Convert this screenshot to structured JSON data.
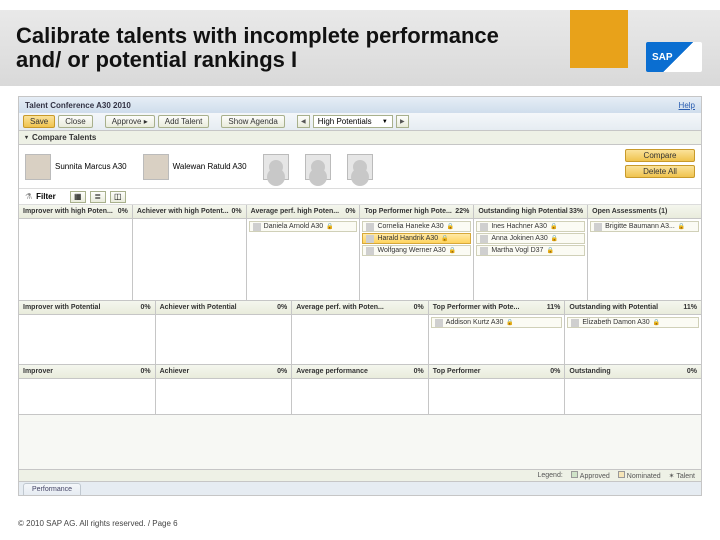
{
  "slide": {
    "title": "Calibrate talents with incomplete performance and/ or potential rankings I",
    "logo": "SAP",
    "footer": "© 2010 SAP AG. All rights reserved. / Page 6"
  },
  "app": {
    "title": "Talent Conference A30 2010",
    "help": "Help"
  },
  "toolbar": {
    "save": "Save",
    "close": "Close",
    "approve": "Approve ▸",
    "add_talent": "Add Talent",
    "show_agenda": "Show Agenda",
    "prev": "◀",
    "next": "▶",
    "dropdown_label": "High Potentials",
    "dropdown_arrow": "▼"
  },
  "section": {
    "compare": "Compare Talents",
    "arrow": "▾"
  },
  "talents": [
    {
      "name": "Sunnita Marcus A30"
    },
    {
      "name": "Walewan Ratuld A30"
    }
  ],
  "side": {
    "compare": "Compare",
    "delete": "Delete All"
  },
  "filter": {
    "label": "Filter",
    "funnel": "▾"
  },
  "grid": {
    "rows": [
      {
        "h": "r1",
        "cells": [
          {
            "title": "Improver with high Poten...",
            "pct": "0%",
            "items": []
          },
          {
            "title": "Achiever with high Potent...",
            "pct": "0%",
            "items": []
          },
          {
            "title": "Average perf. high Poten...",
            "pct": "0%",
            "items": [
              {
                "t": "Daniela Arnold A30"
              }
            ]
          },
          {
            "title": "Top Performer high Pote...",
            "pct": "22%",
            "items": [
              {
                "t": "Cornelia Haneke A30"
              },
              {
                "t": "Harald Handrik A30",
                "sel": true
              },
              {
                "t": "Wolfgang Werner A30"
              }
            ]
          },
          {
            "title": "Outstanding high Potential",
            "pct": "33%",
            "items": [
              {
                "t": "Ines Hachner A30"
              },
              {
                "t": "Anna Jokinen A30"
              },
              {
                "t": "Martha Vogl D37"
              }
            ]
          },
          {
            "title": "Open Assessments (1)",
            "pct": "",
            "items": [
              {
                "t": "Brigitte Baumann A3..."
              }
            ]
          }
        ]
      },
      {
        "h": "r2",
        "cells": [
          {
            "title": "Improver with Potential",
            "pct": "0%",
            "items": []
          },
          {
            "title": "Achiever with Potential",
            "pct": "0%",
            "items": []
          },
          {
            "title": "Average perf. with Poten...",
            "pct": "0%",
            "items": []
          },
          {
            "title": "Top Performer with Pote...",
            "pct": "11%",
            "items": [
              {
                "t": "Addison Kurtz A30"
              }
            ]
          },
          {
            "title": "Outstanding with Potential",
            "pct": "11%",
            "items": [
              {
                "t": "Elizabeth Damon A30"
              }
            ]
          }
        ]
      },
      {
        "h": "r3",
        "cells": [
          {
            "title": "Improver",
            "pct": "0%",
            "items": []
          },
          {
            "title": "Achiever",
            "pct": "0%",
            "items": []
          },
          {
            "title": "Average performance",
            "pct": "0%",
            "items": []
          },
          {
            "title": "Top Performer",
            "pct": "0%",
            "items": []
          },
          {
            "title": "Outstanding",
            "pct": "0%",
            "items": []
          }
        ]
      }
    ]
  },
  "tabs": {
    "performance": "Performance"
  },
  "legend": {
    "a": "Approved",
    "b": "Nominated",
    "c": "Talent",
    "legend": "Legend:"
  }
}
